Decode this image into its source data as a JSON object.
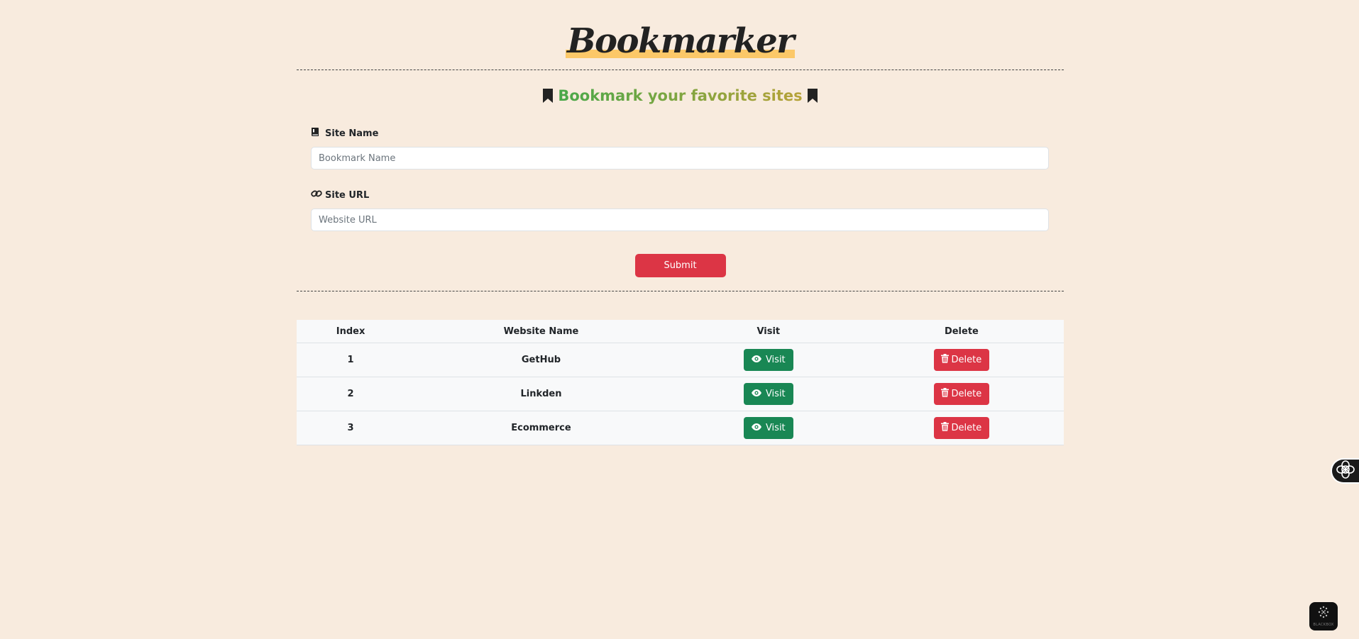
{
  "brand": {
    "title": "Bookmarker",
    "accent": "#fcc868"
  },
  "subtitle": {
    "text": "Bookmark your favorite sites",
    "icon": "bookmark-icon",
    "gradient": [
      "#49a84a",
      "#b7a238"
    ]
  },
  "form": {
    "site_name_label": "Site Name",
    "site_name_icon": "book-icon",
    "site_name_placeholder": "Bookmark Name",
    "site_url_label": "Site URL",
    "site_url_icon": "link-icon",
    "site_url_placeholder": "Website URL",
    "submit_label": "Submit"
  },
  "table": {
    "headers": [
      "Index",
      "Website Name",
      "Visit",
      "Delete"
    ],
    "rows": [
      {
        "index": "1",
        "name": "GetHub",
        "visit_label": "Visit",
        "delete_label": "Delete"
      },
      {
        "index": "2",
        "name": "Linkden",
        "visit_label": "Visit",
        "delete_label": "Delete"
      },
      {
        "index": "3",
        "name": "Ecommerce",
        "visit_label": "Visit",
        "delete_label": "Delete"
      }
    ]
  },
  "widgets": {
    "corner_label": "BLACKBOX"
  },
  "colors": {
    "background": "#f8ebde",
    "danger": "#dc3545",
    "success": "#198754"
  }
}
